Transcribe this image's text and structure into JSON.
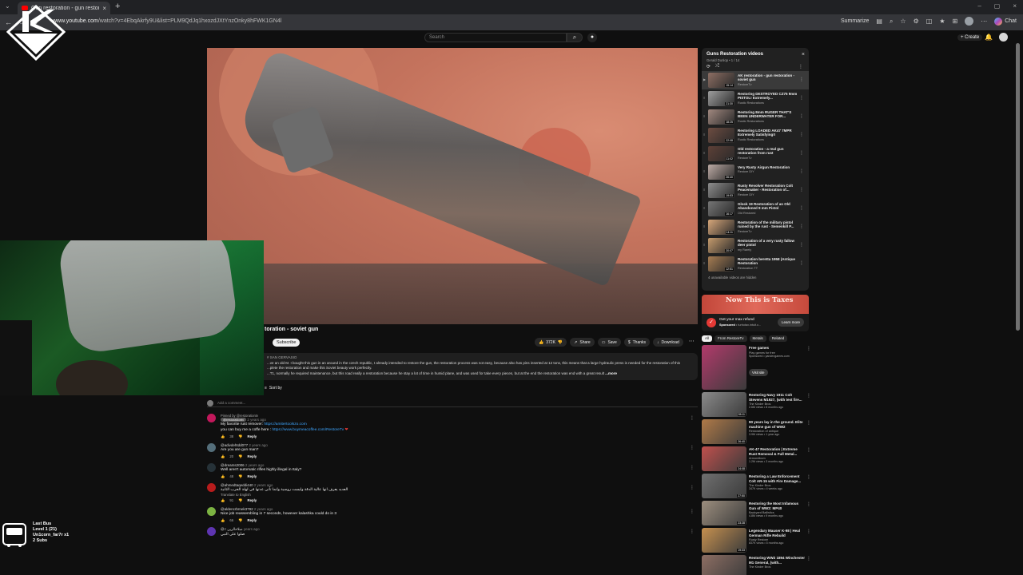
{
  "browser": {
    "tab_title": "Gun restoration - gun restorati...",
    "url_host": "www.youtube.com",
    "url_path": "/watch?v=4EbqAkrfy9U&list=PLM9QdJq1hxozdJXtYnzOnky8hFWK1GN4l",
    "summarize": "Summarize",
    "chat": "Chat"
  },
  "youtube": {
    "search_placeholder": "Search",
    "create": "+ Create"
  },
  "video": {
    "title_tail": "toration - soviet gun",
    "subscribe": "Subscribe",
    "likes": "372K",
    "share": "Share",
    "save": "Save",
    "thanks": "Thanks",
    "download": "Download",
    "description_channel": "# SAN GERVASIO",
    "description_line1": "...ve an old M. I bought this gun in an around in the czech republic, I already intended to restore the gun, the restoration process was not easy, because also has pins inserted at 12 tons, this means that a large hydraulic press is needed for the restoration of this",
    "description_line2": "...plete the restoration and make this Soviet beauty work perfectly.",
    "description_line3": "...T1, normally he required maintenance, but this road really a restoration because he stay a lot of time in humid plane, and was used for take every pieces, but at the end the restoration was end with a great result",
    "description_more": "...more",
    "sort_by": "Sort by"
  },
  "comments": {
    "add_placeholder": "Add a comment...",
    "items": [
      {
        "pinned": "Pinned by @restorationtv",
        "author": "@restorationtv",
        "time": "2 years ago",
        "text1": "My favorite rust remover:",
        "link1": "https://amitertoolszo.com",
        "text2": "you can buy me a coffe here :",
        "link2": "https://www.buymeacoffee.com/RestoreTv",
        "likes": "38",
        "reply": "Reply",
        "color": "#c2185b"
      },
      {
        "author": "@adivdehtdd077",
        "time": "2 years ago",
        "text1": "Are you are gun man?",
        "likes": "20",
        "reply": "Reply",
        "color": "#546e7a"
      },
      {
        "author": "@dreams2006",
        "time": "2 years ago",
        "text1": "Well aren't automatic rifles highly illegal in Italy?",
        "likes": "48",
        "reply": "Reply",
        "color": "#263238"
      },
      {
        "author": "@ahmedtaqeddi440",
        "time": "2 years ago",
        "text1": "العديد يعرف انها عالية الدقة وليست روسية وانما تأتي عدتها في لهلة الحرب الثانية",
        "translate": "Translate to English",
        "likes": "91",
        "reply": "Reply",
        "color": "#b71c1c"
      },
      {
        "author": "@aldencrbrnek3792",
        "time": "2 years ago",
        "text1": "Nice job reassembling in 7 seconds, however kalashka could do in 3",
        "likes": "66",
        "reply": "Reply",
        "color": "#7cb342"
      },
      {
        "author": "@صلاحالزين",
        "time": "2 years ago",
        "text1": "صلوا على النبي",
        "likes": "",
        "reply": "",
        "color": "#5e35b1"
      }
    ]
  },
  "playlist": {
    "title": "Guns Restoration  videos",
    "subtitle": "Gerald Dunlop • 1 / 14",
    "items": [
      {
        "title": "AK restoration - gun restoration - soviet gun",
        "channel": "RestoreTv",
        "dur": "15:14",
        "thumb": "#8d6e63",
        "active": true
      },
      {
        "title": "Restoring DESTROYED CZ75 9mm PISTOL! Extremely...",
        "channel": "Rustic Restorations",
        "dur": "21:30",
        "thumb": "#9e9e9e"
      },
      {
        "title": "Restoring 8mm RUGER THAT'S BEEN UNDERWATER FOR...",
        "channel": "Rustic Restorations",
        "dur": "18:25",
        "thumb": "#a1887f"
      },
      {
        "title": "Restoring LOADED AK47 7MPR Extremely Satisfying!!",
        "channel": "Rustic Restorations",
        "dur": "22:08",
        "thumb": "#6d4c41"
      },
      {
        "title": "Old restoration - a real gun restoration from rust",
        "channel": "RestoreTv",
        "dur": "11:02",
        "thumb": "#5d4037"
      },
      {
        "title": "Very Rusty Airgun Restoration",
        "channel": "Restore DIY",
        "dur": "26:40",
        "thumb": "#bcaaa4"
      },
      {
        "title": "Rusty Revolver Restoration Colt Peacemaker - Restoration of...",
        "channel": "Restore DIY",
        "dur": "19:53",
        "thumb": "#8d8d8d"
      },
      {
        "title": "Glock 19 Restoration of an Old Abandoned 9 mm Pistol",
        "channel": "Old Restored",
        "dur": "16:17",
        "thumb": "#757575"
      },
      {
        "title": "Restoration of the military pistol ruined by the rust - Semenkill P...",
        "channel": "RestoreTv",
        "dur": "14:11",
        "thumb": "#d7a77a"
      },
      {
        "title": "Restoration of a very rusty fallow deer pistol",
        "channel": "my Rarely",
        "dur": "20:07",
        "thumb": "#c49a6c"
      },
      {
        "title": "Restoration beretta 1958 (Antique Restoration",
        "channel": "Restoration TT",
        "dur": "12:51",
        "thumb": "#a67c52"
      }
    ],
    "footer": "4 unavailable videos are hidden"
  },
  "ad": {
    "banner": "Now This is Taxes",
    "title": "Get your max refund",
    "sponsored": "Sponsored",
    "site": "turbotax.intuit.c...",
    "button": "Learn more"
  },
  "chips": [
    "All",
    "From RestoreTv",
    "Metals",
    "Related"
  ],
  "recommendations": [
    {
      "title": "Free games",
      "channel": "Play games for free",
      "views": "Sponsored • yandexgames.com",
      "dur": "",
      "thumb": "#b23a6b",
      "big": true,
      "visit": "Visit site"
    },
    {
      "title": "Restoring Navy 1911 Colt Stevens M1927, (with test fire...",
      "channel": "The Kinder Bros",
      "views": "2.6M views • 8 months ago",
      "dur": "35:11",
      "thumb": "#8a8a8a"
    },
    {
      "title": "90 years lay in the ground. Elite machine gun of WW2",
      "channel": "Restoration of antique",
      "views": "3.9M views • 1 year ago",
      "dur": "26:40",
      "thumb": "#b07a48"
    },
    {
      "title": "AK-47 Restoration | Extreme Rust Removal & Full Metal...",
      "channel": "Armorelbum",
      "views": "1.2M views • 3 months ago",
      "dur": "24:08",
      "thumb": "#c0504d"
    },
    {
      "title": "Restoring a Law Enforcement Colt AR-15 with Fire Damage...",
      "channel": "The Kinder Bros",
      "views": "347K views • 4 weeks ago",
      "dur": "27:50",
      "thumb": "#6f6f6f"
    },
    {
      "title": "Restoring the Most Infamous Gun of WW2: MP40",
      "channel": "Backyard Ballistics",
      "views": "4.8M views • 9 months ago",
      "dur": "23:28",
      "thumb": "#9c8e7e"
    },
    {
      "title": "Legendary Mauser K-98 | Heal German Rifle Rebuild",
      "channel": "Rusty Restore",
      "views": "837K views • 5 months ago",
      "dur": "19:33",
      "thumb": "#c6904f"
    },
    {
      "title": "Restoring WW2 1894 Winchester M1 General, (with...",
      "channel": "The Kinder Bros",
      "views": "",
      "dur": "",
      "thumb": "#8d6e63"
    }
  ],
  "overlay": {
    "line1": "Last Bus",
    "line2": "Level 1  (21)",
    "line3": "Un1corn_far7r x1",
    "line4": "2 Subs"
  }
}
